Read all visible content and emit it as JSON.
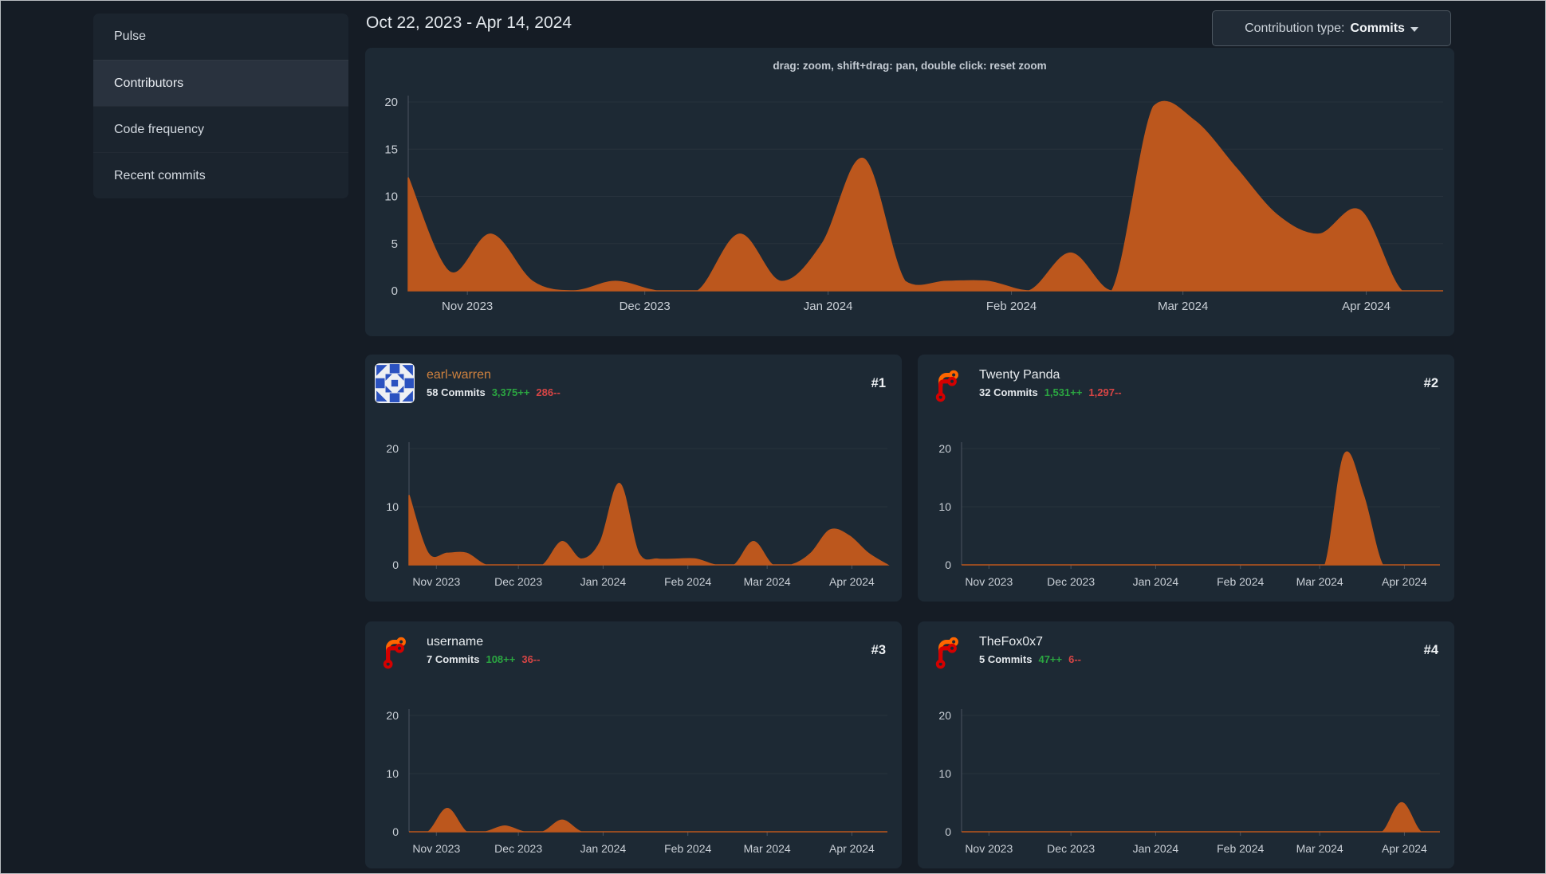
{
  "sidebar": {
    "items": [
      {
        "label": "Pulse",
        "active": false
      },
      {
        "label": "Contributors",
        "active": true
      },
      {
        "label": "Code frequency",
        "active": false
      },
      {
        "label": "Recent commits",
        "active": false
      }
    ]
  },
  "header": {
    "date_range": "Oct 22, 2023 - Apr 14, 2024",
    "type_button": {
      "label": "Contribution type:",
      "value": "Commits"
    }
  },
  "main_chart": {
    "hint": "drag: zoom, shift+drag: pan, double click: reset zoom"
  },
  "colors": {
    "area": "#bc571d",
    "grid": "#28323d",
    "axis_line": "#4a545f",
    "axis_text": "#c9cfd6",
    "green": "#2ba641",
    "red": "#d64545",
    "card_bg": "#1d2934",
    "page_bg": "#151c25",
    "link_orange": "#d0823e"
  },
  "axis": {
    "start_date": "2023-10-22",
    "end_date": "2024-04-14",
    "step_days": 7,
    "total_days": 175,
    "months": [
      {
        "label": "Nov 2023",
        "day": 10
      },
      {
        "label": "Dec 2023",
        "day": 40
      },
      {
        "label": "Jan 2024",
        "day": 71
      },
      {
        "label": "Feb 2024",
        "day": 102
      },
      {
        "label": "Mar 2024",
        "day": 131
      },
      {
        "label": "Apr 2024",
        "day": 162
      }
    ]
  },
  "chart_data": [
    {
      "id": "main",
      "type": "area",
      "series_name": "all-contributors-commits-per-week",
      "xlabel": "",
      "ylabel": "",
      "ylim": [
        0,
        20
      ],
      "yticks": [
        0,
        5,
        10,
        15,
        20
      ],
      "x_categories": "weeks from 2023-10-22 to 2024-04-14",
      "values": [
        12,
        2,
        6,
        1,
        0,
        1,
        0,
        0,
        6,
        1,
        5,
        14,
        1,
        1,
        1,
        0,
        4,
        0,
        19.5,
        18,
        13,
        8,
        6,
        8.5,
        0,
        0
      ]
    },
    {
      "id": "earl-warren",
      "type": "area",
      "series_name": "earl-warren-commits-per-week",
      "ylim": [
        0,
        20
      ],
      "yticks": [
        0,
        10,
        20
      ],
      "values": [
        12,
        2,
        2,
        2,
        0,
        0,
        0,
        0,
        4,
        1,
        4,
        14,
        2,
        1,
        1,
        1,
        0,
        0,
        4,
        0,
        0,
        2,
        6,
        5,
        2,
        0
      ]
    },
    {
      "id": "twenty-panda",
      "type": "area",
      "series_name": "twenty-panda-commits-per-week",
      "ylim": [
        0,
        20
      ],
      "yticks": [
        0,
        10,
        20
      ],
      "values": [
        0,
        0,
        0,
        0,
        0,
        0,
        0,
        0,
        0,
        0,
        0,
        0,
        0,
        0,
        0,
        0,
        0,
        0,
        0,
        0,
        19,
        12,
        0,
        0,
        0,
        0
      ]
    },
    {
      "id": "username",
      "type": "area",
      "series_name": "username-commits-per-week",
      "ylim": [
        0,
        20
      ],
      "yticks": [
        0,
        10,
        20
      ],
      "values": [
        0,
        0,
        4,
        0,
        0,
        1,
        0,
        0,
        2,
        0,
        0,
        0,
        0,
        0,
        0,
        0,
        0,
        0,
        0,
        0,
        0,
        0,
        0,
        0,
        0,
        0
      ]
    },
    {
      "id": "thefox0x7",
      "type": "area",
      "series_name": "thefox0x7-commits-per-week",
      "ylim": [
        0,
        20
      ],
      "yticks": [
        0,
        10,
        20
      ],
      "values": [
        0,
        0,
        0,
        0,
        0,
        0,
        0,
        0,
        0,
        0,
        0,
        0,
        0,
        0,
        0,
        0,
        0,
        0,
        0,
        0,
        0,
        0,
        0,
        5,
        0,
        0
      ]
    }
  ],
  "contributors": [
    {
      "rank": "#1",
      "name": "earl-warren",
      "name_color": "#d0823e",
      "avatar": "identicon-blue",
      "commits": "58 Commits",
      "additions": "3,375++",
      "deletions": "286--"
    },
    {
      "rank": "#2",
      "name": "Twenty Panda",
      "name_color": "#e8ecef",
      "avatar": "forgejo-logo",
      "commits": "32 Commits",
      "additions": "1,531++",
      "deletions": "1,297--"
    },
    {
      "rank": "#3",
      "name": "username",
      "name_color": "#e8ecef",
      "avatar": "forgejo-logo",
      "commits": "7 Commits",
      "additions": "108++",
      "deletions": "36--"
    },
    {
      "rank": "#4",
      "name": "TheFox0x7",
      "name_color": "#e8ecef",
      "avatar": "forgejo-logo",
      "commits": "5 Commits",
      "additions": "47++",
      "deletions": "6--"
    }
  ]
}
